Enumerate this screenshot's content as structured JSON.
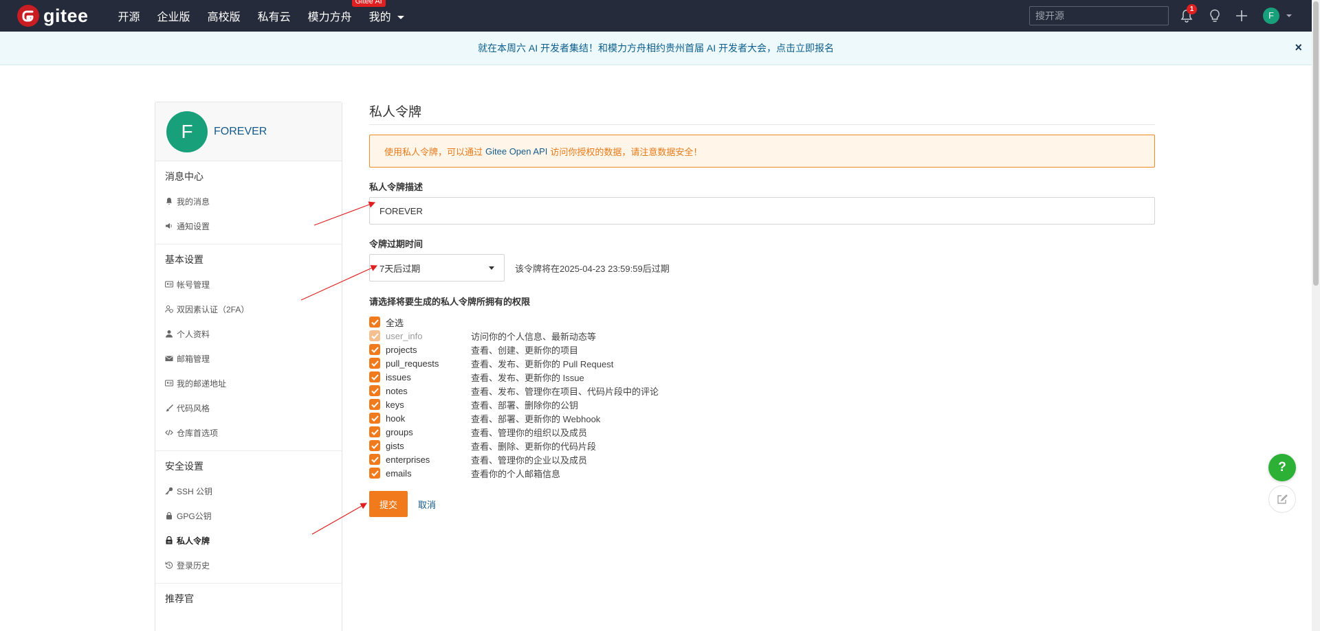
{
  "nav": {
    "logo_text": "gitee",
    "items": [
      {
        "label": "开源"
      },
      {
        "label": "企业版"
      },
      {
        "label": "高校版"
      },
      {
        "label": "私有云"
      },
      {
        "label": "模力方舟",
        "badge": "Gitee AI"
      },
      {
        "label": "我的"
      }
    ],
    "search_placeholder": "搜开源",
    "bell_count": "1",
    "avatar_letter": "F"
  },
  "announcement": {
    "text": "就在本周六 AI 开发者集结！和模力方舟相约贵州首届 AI 开发者大会，点击立即报名",
    "close": "×"
  },
  "sidebar": {
    "avatar_letter": "F",
    "username": "FOREVER",
    "groups": [
      {
        "title": "消息中心",
        "items": [
          {
            "label": "我的消息",
            "icon": "bell-icon"
          },
          {
            "label": "通知设置",
            "icon": "speaker-icon"
          }
        ]
      },
      {
        "title": "基本设置",
        "items": [
          {
            "label": "帐号管理",
            "icon": "id-card-icon"
          },
          {
            "label": "双因素认证（2FA）",
            "icon": "user-shield-icon"
          },
          {
            "label": "个人资料",
            "icon": "user-icon"
          },
          {
            "label": "邮箱管理",
            "icon": "envelope-icon"
          },
          {
            "label": "我的邮递地址",
            "icon": "address-card-icon"
          },
          {
            "label": "代码风格",
            "icon": "brush-icon"
          },
          {
            "label": "仓库首选项",
            "icon": "code-icon"
          }
        ]
      },
      {
        "title": "安全设置",
        "items": [
          {
            "label": "SSH 公钥",
            "icon": "key-icon"
          },
          {
            "label": "GPG公钥",
            "icon": "lock-icon"
          },
          {
            "label": "私人令牌",
            "icon": "token-icon",
            "active": true
          },
          {
            "label": "登录历史",
            "icon": "history-icon"
          }
        ]
      },
      {
        "title": "推荐官",
        "items": []
      }
    ]
  },
  "main": {
    "title": "私人令牌",
    "warning": {
      "before": "使用私人令牌，可以通过",
      "link": "Gitee Open API",
      "after": "访问你授权的数据，请注意数据安全！"
    },
    "desc_label": "私人令牌描述",
    "desc_value": "FOREVER",
    "expire_label": "令牌过期时间",
    "expire_selected": "7天后过期",
    "expire_hint": "该令牌将在2025-04-23 23:59:59后过期",
    "perm_label": "请选择将要生成的私人令牌所拥有的权限",
    "select_all": "全选",
    "permissions": [
      {
        "name": "user_info",
        "desc": "访问你的个人信息、最新动态等",
        "disabled": true
      },
      {
        "name": "projects",
        "desc": "查看、创建、更新你的项目"
      },
      {
        "name": "pull_requests",
        "desc": "查看、发布、更新你的 Pull Request"
      },
      {
        "name": "issues",
        "desc": "查看、发布、更新你的 Issue"
      },
      {
        "name": "notes",
        "desc": "查看、发布、管理你在项目、代码片段中的评论"
      },
      {
        "name": "keys",
        "desc": "查看、部署、删除你的公钥"
      },
      {
        "name": "hook",
        "desc": "查看、部署、更新你的 Webhook"
      },
      {
        "name": "groups",
        "desc": "查看、管理你的组织以及成员"
      },
      {
        "name": "gists",
        "desc": "查看、删除、更新你的代码片段"
      },
      {
        "name": "enterprises",
        "desc": "查看、管理你的企业以及成员"
      },
      {
        "name": "emails",
        "desc": "查看你的个人邮箱信息"
      }
    ],
    "submit": "提交",
    "cancel": "取消"
  },
  "floating": {
    "help": "?"
  },
  "colors": {
    "accent": "#f07a1c",
    "nav_bg": "#252b3a",
    "link": "#145a8a",
    "annotation_arrow": "#e02020"
  }
}
